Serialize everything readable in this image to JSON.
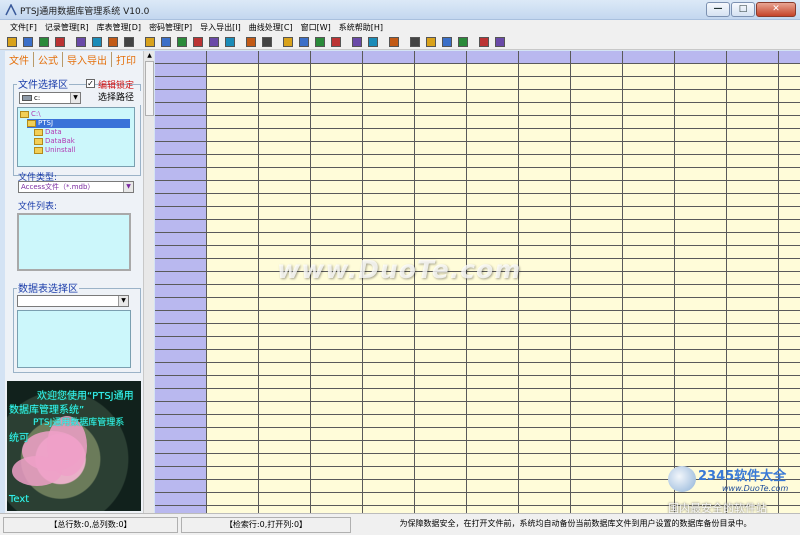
{
  "window": {
    "title": "PTSJ通用数据库管理系统 V10.0",
    "minimize": "—",
    "maximize": "□",
    "close": "✕"
  },
  "menu": [
    "文件[F]",
    "记录管理[R]",
    "库表管理[D]",
    "密码管理[P]",
    "导入导出[I]",
    "曲线处理[C]",
    "窗口[W]",
    "系统帮助[H]"
  ],
  "toolbar_icons": [
    "add-record-icon",
    "users-icon",
    "users-edit-icon",
    "exit-icon",
    "sep",
    "tools-icon",
    "table-icon",
    "search-icon",
    "document-icon",
    "sep",
    "pen-icon",
    "scissors-icon",
    "brush-icon",
    "book-blue-icon",
    "book-red-icon",
    "layers-icon",
    "sep",
    "image-icon",
    "download-icon",
    "sep",
    "pencil-icon",
    "note-icon",
    "record-icon",
    "save-icon",
    "sep",
    "import-icon",
    "grid-icon",
    "sep",
    "chart-icon",
    "sep",
    "help1-icon",
    "help2-icon",
    "help3-icon",
    "help4-icon",
    "sep",
    "book-icon",
    "monitor-icon"
  ],
  "tabs": [
    "文件",
    "公式",
    "导入导出",
    "打印"
  ],
  "file_select": {
    "group_label": "文件选择区",
    "lock_checked": true,
    "lock_label": "编辑锁定",
    "drive": "c:",
    "path_button": "选择路径",
    "tree": [
      {
        "label": "C:\\",
        "indent": 0,
        "selected": false
      },
      {
        "label": "PTSJ",
        "indent": 1,
        "selected": true
      },
      {
        "label": "Data",
        "indent": 2,
        "selected": false
      },
      {
        "label": "DataBak",
        "indent": 2,
        "selected": false
      },
      {
        "label": "Uninstall",
        "indent": 2,
        "selected": false
      }
    ],
    "file_type_label": "文件类型:",
    "file_type_value": "Access文件（*.mdb）",
    "file_list_label": "文件列表:"
  },
  "table_select": {
    "group_label": "数据表选择区"
  },
  "welcome": {
    "lines": [
      "欢迎您使用“PTSJ通用",
      "数据库管理系统”",
      "PTSJ通用数据库管理系",
      "统可",
      "",
      "",
      "",
      "Text"
    ]
  },
  "grid": {
    "header_color": "#b9b8ef",
    "cell_color": "#fffcd9"
  },
  "watermark": "www.DuoTe.com",
  "corner": {
    "brand": "2345软件大全",
    "url": "www.DuoTe.com",
    "slogan": "国内最安全的软件站"
  },
  "status": {
    "total": "【总行数:0,总列数:0】",
    "search": "【检索行:0,打开列:0】",
    "message": "为保障数据安全，在打开文件前，系统均自动备份当前数据库文件到用户设置的数据库备份目录中。"
  }
}
